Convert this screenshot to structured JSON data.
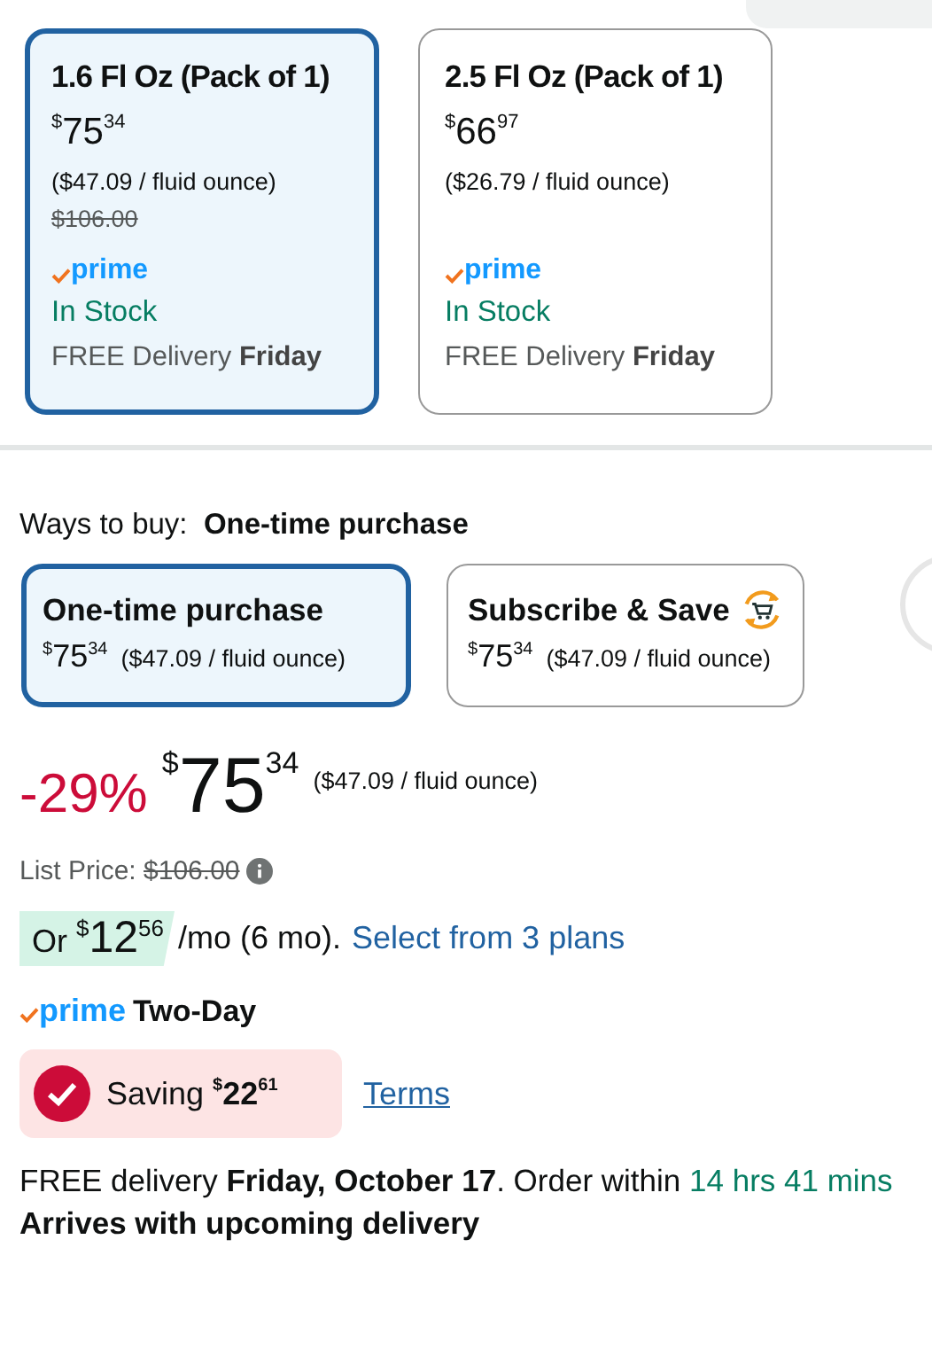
{
  "size_options": [
    {
      "title": "1.6 Fl Oz (Pack of 1)",
      "price": {
        "currency": "$",
        "whole": "75",
        "fraction": "34"
      },
      "unit_price": "($47.09 / fluid ounce)",
      "list_price": "$106.00",
      "prime": "prime",
      "stock": "In Stock",
      "delivery": "FREE Delivery",
      "delivery_day": "Friday",
      "selected": true
    },
    {
      "title": "2.5 Fl Oz (Pack of 1)",
      "price": {
        "currency": "$",
        "whole": "66",
        "fraction": "97"
      },
      "unit_price": "($26.79 / fluid ounce)",
      "prime": "prime",
      "stock": "In Stock",
      "delivery": "FREE Delivery",
      "delivery_day": "Friday",
      "selected": false
    }
  ],
  "ways_to_buy": {
    "label": "Ways to buy:",
    "value": "One-time purchase"
  },
  "purchase_options": [
    {
      "title": "One-time purchase",
      "price": {
        "currency": "$",
        "whole": "75",
        "fraction": "34"
      },
      "unit_price": "($47.09 / fluid ounce)",
      "kind": "plain",
      "selected": true
    },
    {
      "title": "Subscribe & Save",
      "price": {
        "currency": "$",
        "whole": "75",
        "fraction": "34"
      },
      "unit_price": "($47.09 / fluid ounce)",
      "kind": "subscribe",
      "selected": false
    }
  ],
  "price": {
    "discount": "-29%",
    "currency": "$",
    "whole": "75",
    "fraction": "34",
    "unit_price": "($47.09 / fluid ounce)"
  },
  "list_price": {
    "label": "List Price:",
    "value": "$106.00"
  },
  "installment": {
    "prefix": "Or",
    "currency": "$",
    "whole": "12",
    "fraction": "56",
    "suffix": "/mo (6 mo).",
    "link": "Select from 3 plans"
  },
  "prime_badge": {
    "logo": "prime",
    "label": "Two-Day"
  },
  "saving": {
    "label": "Saving",
    "currency": "$",
    "whole": "22",
    "fraction": "61",
    "terms": "Terms"
  },
  "delivery": {
    "text": "FREE delivery **Friday, October 17**. Order within",
    "countdown": "14 hrs 41 mins"
  },
  "arrival": "Arrives with upcoming delivery"
}
